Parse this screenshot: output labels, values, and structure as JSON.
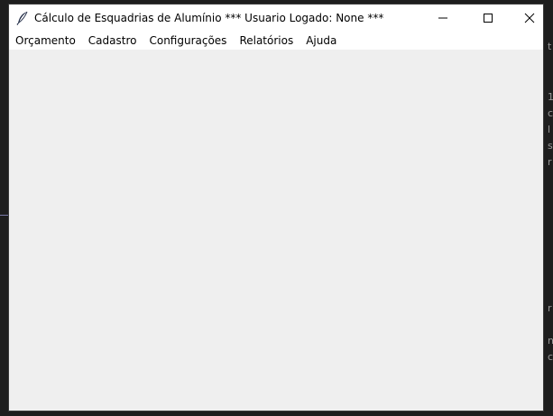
{
  "window": {
    "title": "Cálculo de Esquadrias de Alumínio *** Usuario Logado: None ***",
    "icon": "feather-icon",
    "controls": {
      "minimize": "minimize-icon",
      "maximize": "maximize-icon",
      "close": "close-icon"
    }
  },
  "menubar": {
    "items": [
      {
        "label": "Orçamento"
      },
      {
        "label": "Cadastro"
      },
      {
        "label": "Configurações"
      },
      {
        "label": "Relatórios"
      },
      {
        "label": "Ajuda"
      }
    ]
  },
  "background_fragments": [
    "t",
    "1",
    "c",
    "l",
    "s",
    "r",
    "r",
    "n",
    "c"
  ]
}
